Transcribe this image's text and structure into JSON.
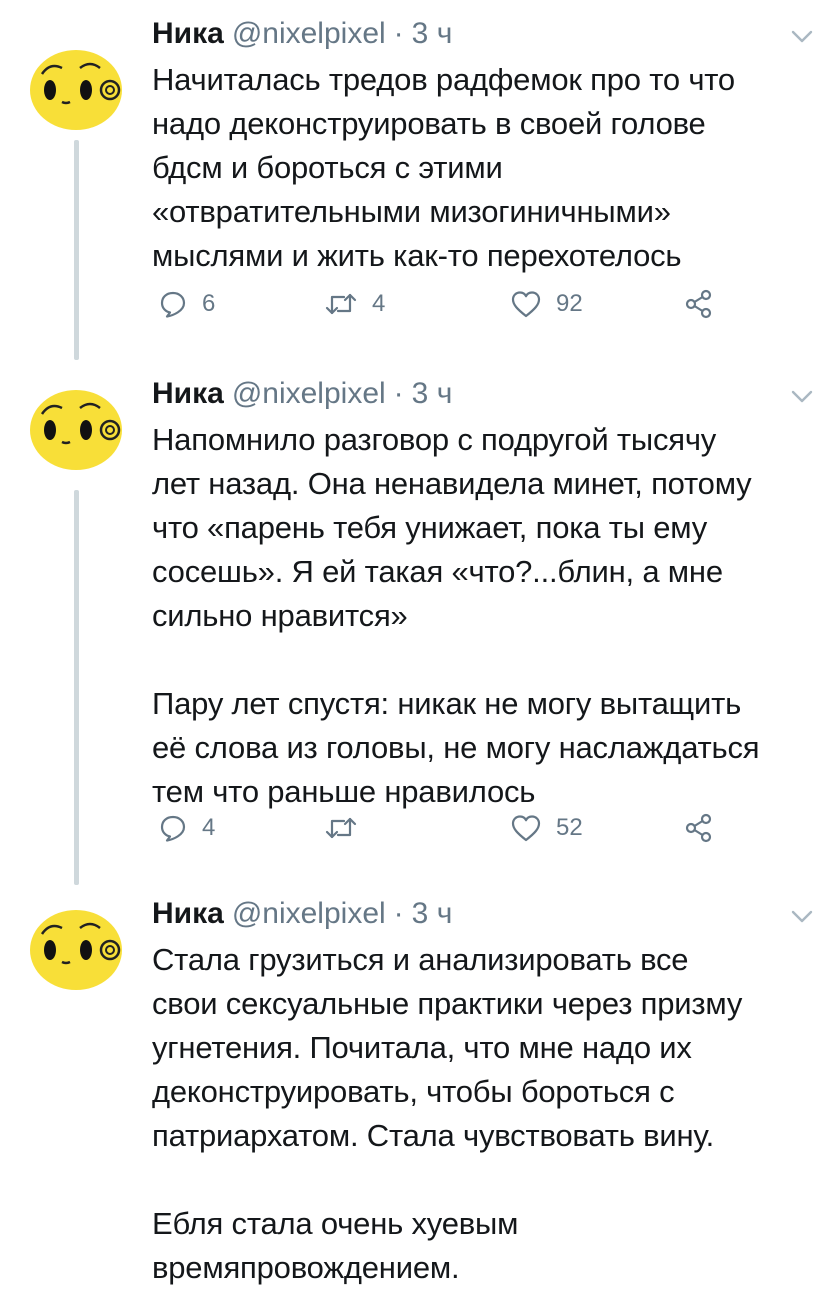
{
  "tweets": [
    {
      "author": "Ника",
      "handle": "@nixelpixel",
      "time": "3 ч",
      "paragraphs": [
        "Начиталась тредов радфемок про то что\nнадо деконструировать в своей голове\nбдсм и бороться с этими\n«отвратительными мизогиничными»\nмыслями и жить как-то перехотелось"
      ],
      "replies": "6",
      "retweets": "4",
      "likes": "92"
    },
    {
      "author": "Ника",
      "handle": "@nixelpixel",
      "time": "3 ч",
      "paragraphs": [
        "Напомнило разговор с подругой тысячу\nлет назад. Она ненавидела минет, потому\nчто «парень тебя унижает, пока ты ему\nсосешь». Я ей такая «что?...блин, а мне\nсильно нравится»",
        "Пару лет спустя: никак не могу вытащить\neё слова из головы, не могу наслаждаться\nтем что раньше нравилось"
      ],
      "replies": "4",
      "retweets": "",
      "likes": "52"
    },
    {
      "author": "Ника",
      "handle": "@nixelpixel",
      "time": "3 ч",
      "paragraphs": [
        "Стала грузиться и анализировать все\nсвои сексуальные практики через призму\nугнетения. Почитала, что мне надо их\nдеконструировать, чтобы бороться с\nпатриархатом. Стала чувствовать вину.",
        "Ебля стала очень хуевым\nвремяпровождением."
      ]
    }
  ],
  "icons": {
    "reply": "reply-icon",
    "retweet": "retweet-icon",
    "like": "heart-icon",
    "share": "share-icon",
    "menu": "chevron-down-icon"
  },
  "colors": {
    "text": "#14171a",
    "muted": "#657786",
    "thread_line": "#cfd8dc",
    "avatar_fill": "#f8df38",
    "background": "#ffffff"
  }
}
